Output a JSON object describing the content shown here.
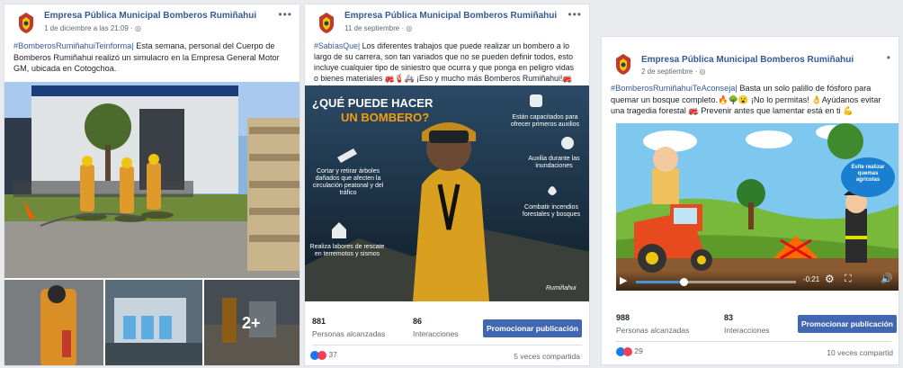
{
  "page_name": "Empresa Pública Municipal Bomberos Rumiñahui",
  "posts": [
    {
      "date": "1 de diciembre a las 21:09 · ",
      "hashtag": "#BomberosRumiñahuiTeinforma|",
      "text": " Esta semana, personal del Cuerpo de Bomberos Rumiñahui realizó un simulacro en la Empresa General Motor GM, ubicada en Cotogchoa.",
      "more_photos": "2+"
    },
    {
      "date": "11 de septiembre · ",
      "hashtag": "#SabíasQue|",
      "text": " Los diferentes trabajos que puede realizar un bombero a lo largo de su carrera, son tan variados que no se pueden definir todos, esto incluye cualquier tipo de siniestro que ocurra y que ponga en peligro vidas o bienes materiales 🚒🧯🚑 ¡Eso y mucho más Bomberos Rumiñahui!🚒🧯",
      "infographic": {
        "title_line1": "¿QUÉ PUEDE HACER",
        "title_line2": "UN BOMBERO?",
        "item1": "Están capacitados para ofrecer primeros auxilios",
        "item2": "Auxilia durante las inundaciones",
        "item3": "Combatir incendios forestales y bosques",
        "item4": "Cortar y retirar árboles dañados que afecten la circulación peatonal y del tráfico",
        "item5": "Realiza labores de rescate en terremotos y sismos",
        "brand": "Rumiñahui"
      },
      "reach": "881",
      "reach_label": "Personas alcanzadas",
      "interactions": "86",
      "interactions_label": "Interacciones",
      "promote": "Promocionar publicación",
      "reactions": "37",
      "shares": "5 veces compartida"
    },
    {
      "date": "2 de septiembre · ",
      "hashtag": "#BomberosRumiñahuiTeAconseja|",
      "text": " Basta un solo palillo de fósforo para quemar un bosque completo.🔥🌳😮 ¡No lo permitas! 👌Ayúdanos evitar una tragedia forestal 🚒 Prevenir antes que lamentar está en ti 💪",
      "bubble": "Evite realizar quemas agrícolas",
      "time": "-0:21",
      "video_progress": 0.3,
      "reach": "988",
      "reach_label": "Personas alcanzadas",
      "interactions": "83",
      "interactions_label": "Interacciones",
      "promote": "Promocionar publicación",
      "reactions": "29",
      "shares": "10 veces compartid"
    }
  ]
}
